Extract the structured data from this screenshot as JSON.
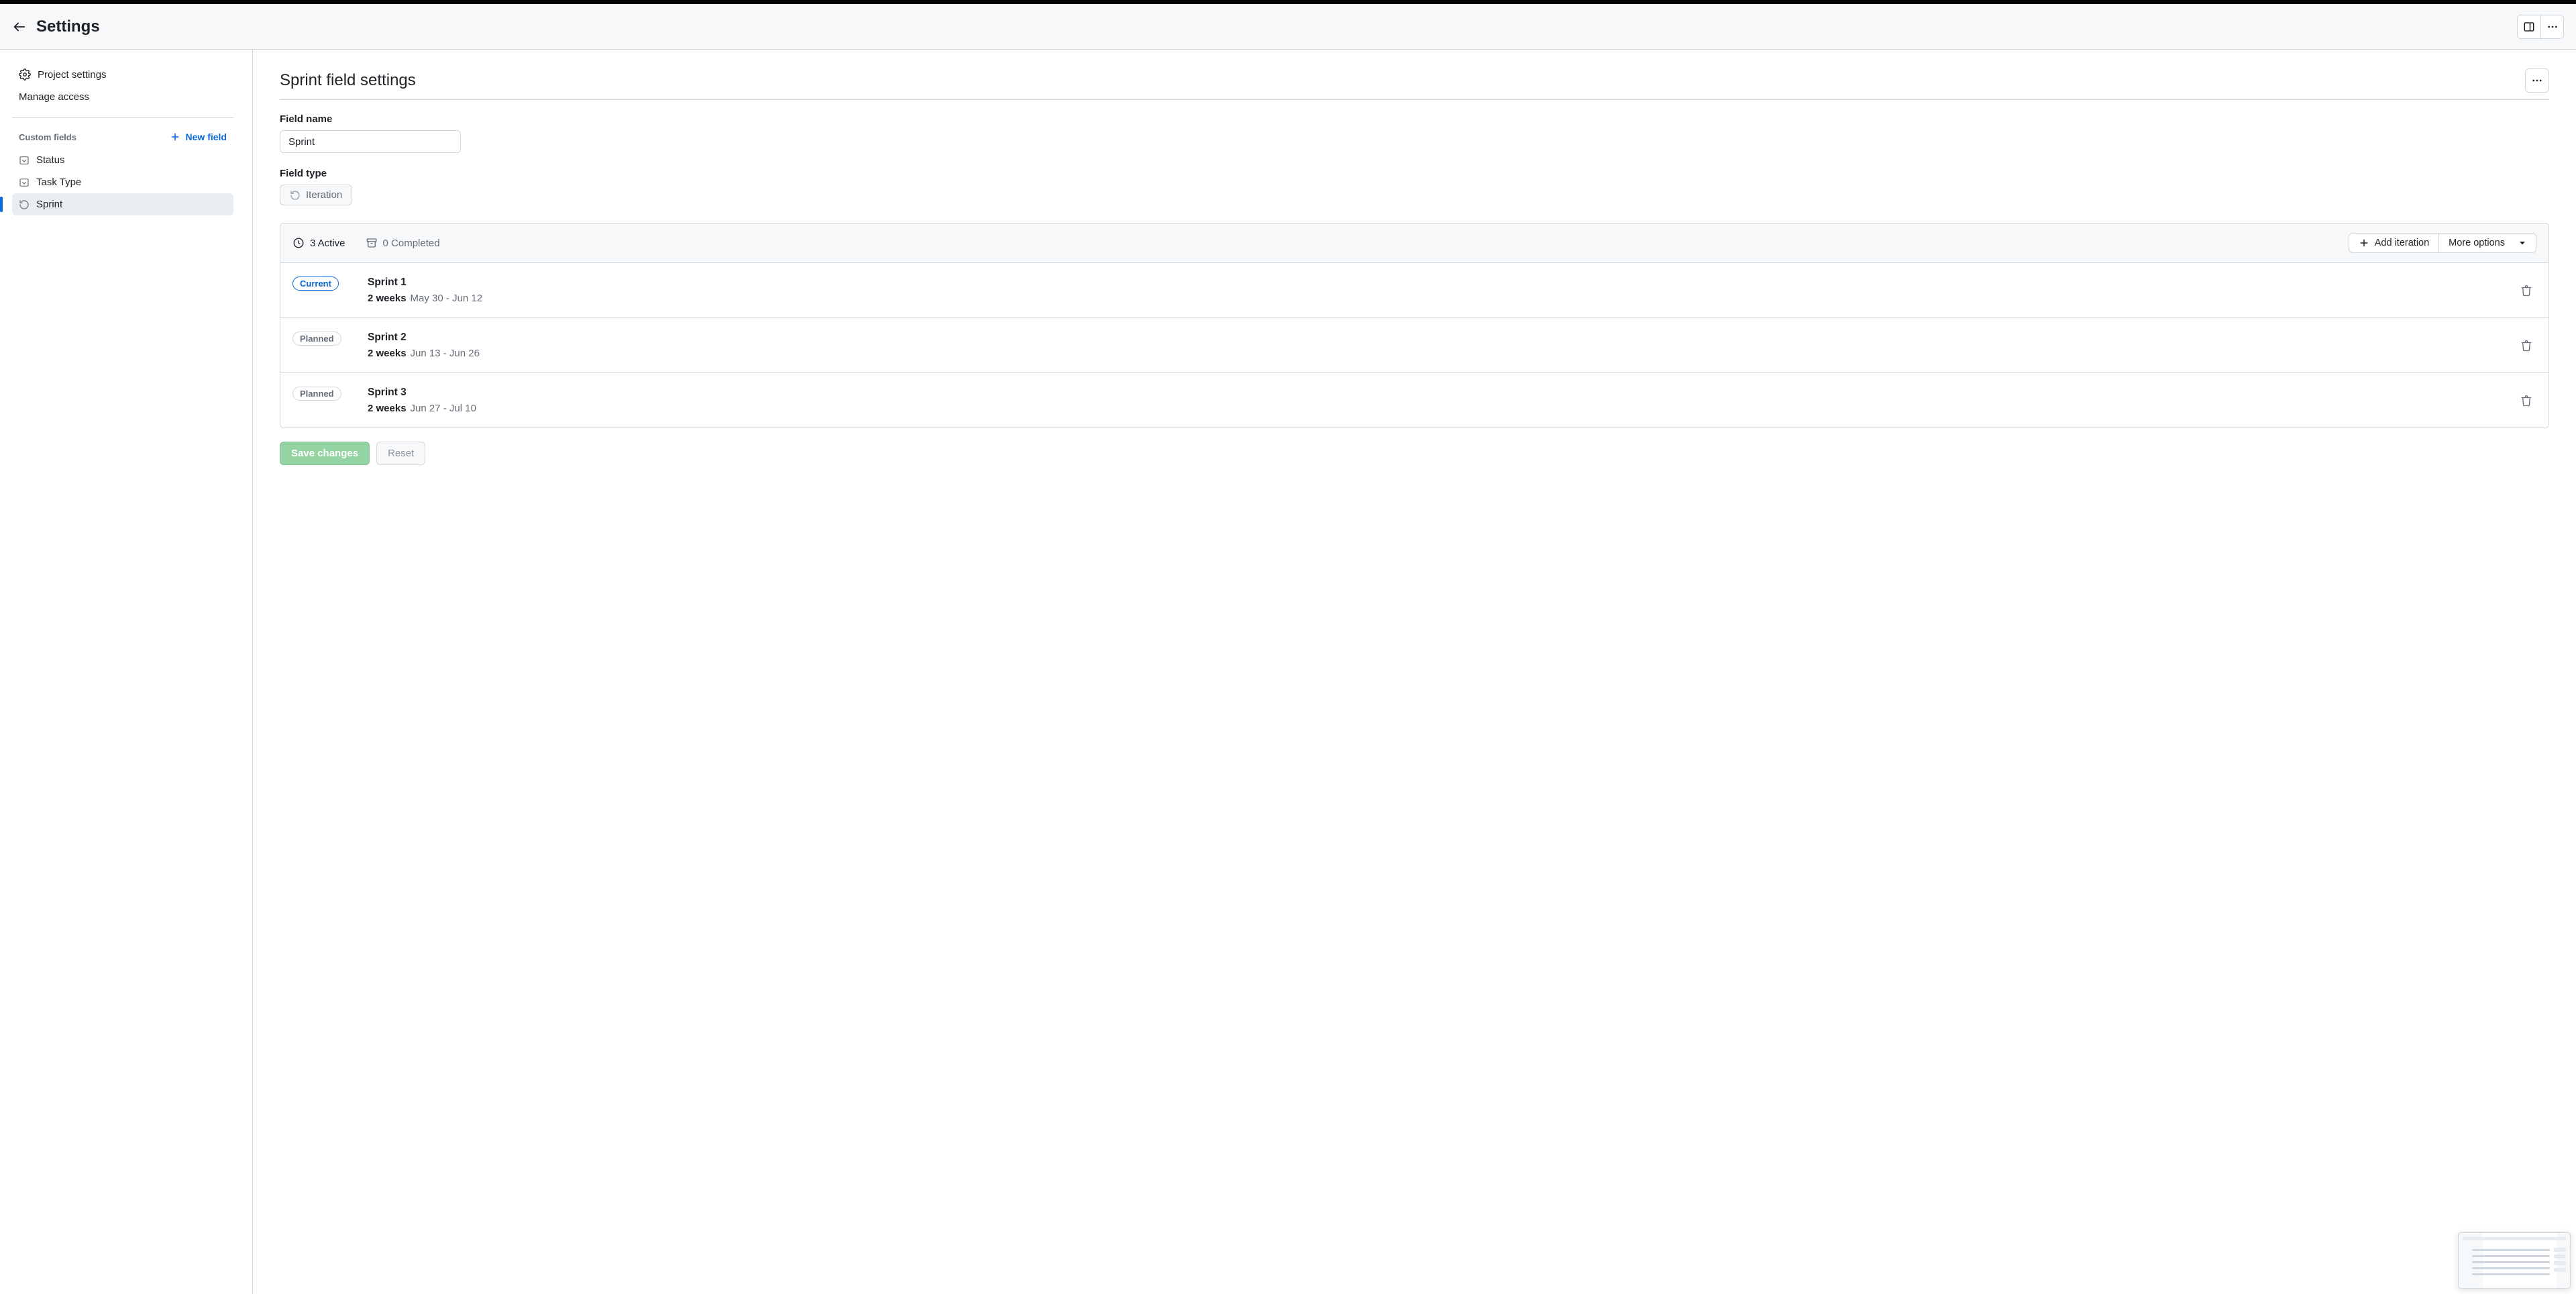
{
  "header": {
    "title": "Settings"
  },
  "sidebar": {
    "project_settings": "Project settings",
    "manage_access": "Manage access",
    "custom_fields_label": "Custom fields",
    "new_field_label": "New field",
    "fields": [
      {
        "label": "Status",
        "icon": "single-select"
      },
      {
        "label": "Task Type",
        "icon": "single-select"
      },
      {
        "label": "Sprint",
        "icon": "iteration"
      }
    ]
  },
  "main": {
    "title": "Sprint field settings",
    "field_name_label": "Field name",
    "field_name_value": "Sprint",
    "field_type_label": "Field type",
    "field_type_value": "Iteration",
    "tabs": {
      "active": "3 Active",
      "completed": "0 Completed"
    },
    "actions": {
      "add_iteration": "Add iteration",
      "more_options": "More options"
    },
    "iterations": [
      {
        "badge": "Current",
        "badge_style": "current",
        "name": "Sprint 1",
        "duration": "2 weeks",
        "range": "May 30 - Jun 12"
      },
      {
        "badge": "Planned",
        "badge_style": "planned",
        "name": "Sprint 2",
        "duration": "2 weeks",
        "range": "Jun 13 - Jun 26"
      },
      {
        "badge": "Planned",
        "badge_style": "planned",
        "name": "Sprint 3",
        "duration": "2 weeks",
        "range": "Jun 27 - Jul 10"
      }
    ],
    "save_label": "Save changes",
    "reset_label": "Reset"
  }
}
